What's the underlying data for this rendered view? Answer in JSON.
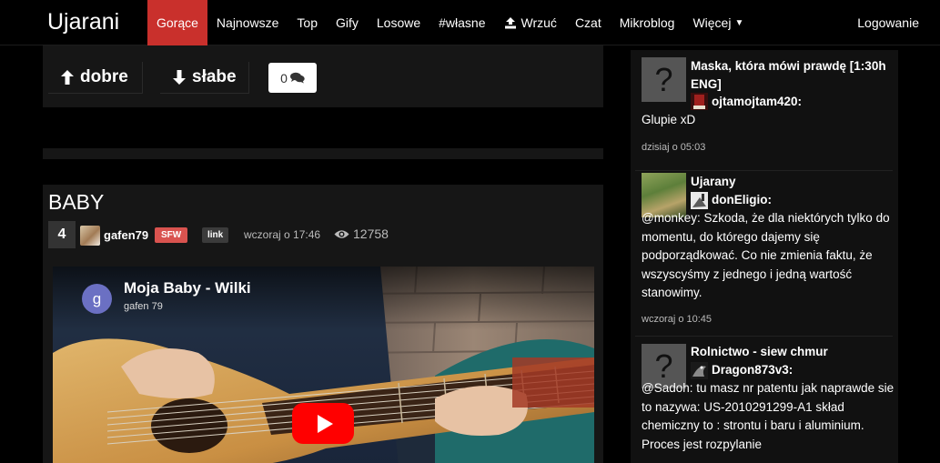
{
  "nav": {
    "brand": "Ujarani",
    "items": [
      "Gorące",
      "Najnowsze",
      "Top",
      "Gify",
      "Losowe",
      "#własne",
      "Wrzuć",
      "Czat",
      "Mikroblog",
      "Więcej"
    ],
    "login": "Logowanie"
  },
  "votes": {
    "up_label": "dobre",
    "down_label": "słabe",
    "comments_count": "0"
  },
  "post": {
    "title": "BABY",
    "score": "4",
    "author": "gafen79",
    "sfw_badge": "SFW",
    "link_badge": "link",
    "time": "wczoraj o 17:46",
    "views": "12758",
    "video": {
      "title": "Moja Baby - Wilki",
      "channel": "gafen 79",
      "avatar_letter": "g"
    }
  },
  "sidebar": {
    "items": [
      {
        "title": "Maska, która mówi prawdę [1:30h ENG]",
        "user": "ojtamojtam420:",
        "text": "Glupie xD",
        "date": "dzisiaj o 05:03",
        "thumb": "question-mark"
      },
      {
        "title": "Ujarany",
        "user": "donEligio:",
        "text": "@monkey: Szkoda, że dla niektórych tylko do momentu, do którego dajemy się podporządkować. Co nie zmienia faktu, że wszyscyśmy z jednego i jedną wartość stanowimy.",
        "date": "wczoraj o 10:45",
        "thumb": "landscape"
      },
      {
        "title": "Rolnictwo - siew chmur",
        "user": "Dragon873v3:",
        "text": "@Sadoh: tu masz nr patentu jak naprawde sie to nazywa: US-2010291299-A1 skład chemiczny to : strontu i baru i aluminium. Proces jest rozpylanie",
        "date": "",
        "thumb": "question-mark"
      }
    ]
  },
  "colors": {
    "accent": "#c9302c",
    "badge_sfw": "#d9534f",
    "youtube_red": "#ff0000"
  }
}
